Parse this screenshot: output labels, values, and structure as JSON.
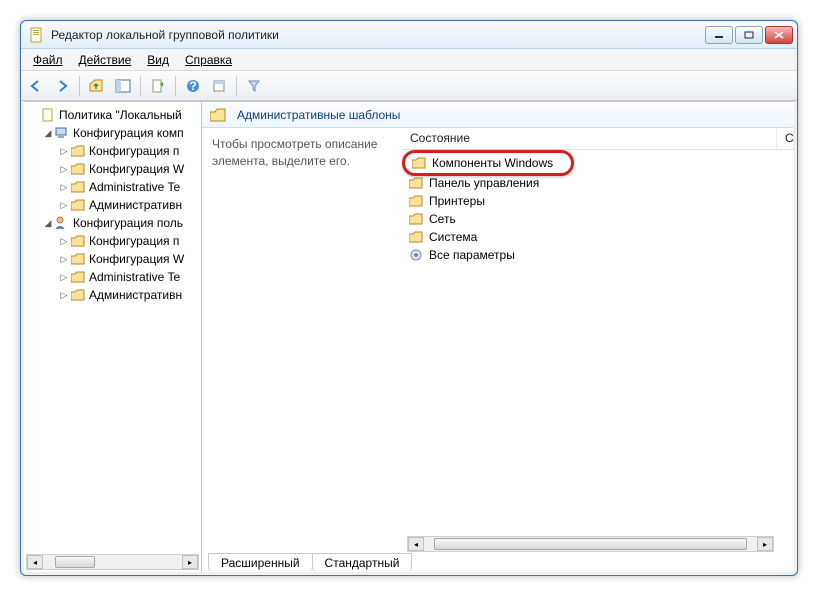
{
  "title": "Редактор локальной групповой политики",
  "menus": {
    "file": "Файл",
    "action": "Действие",
    "view": "Вид",
    "help": "Справка"
  },
  "tree": {
    "root": "Политика \"Локальный",
    "compConfig": "Конфигурация комп",
    "compItems": [
      "Конфигурация п",
      "Конфигурация W",
      "Administrative Te",
      "Административн"
    ],
    "userConfig": "Конфигурация поль",
    "userItems": [
      "Конфигурация п",
      "Конфигурация W",
      "Administrative Te",
      "Административн"
    ]
  },
  "content": {
    "heading": "Административные шаблоны",
    "descLine1": "Чтобы просмотреть описание",
    "descLine2": "элемента, выделите его.",
    "stateCol": "Состояние",
    "items": [
      "Компоненты Windows",
      "Панель управления",
      "Принтеры",
      "Сеть",
      "Система",
      "Все параметры"
    ]
  },
  "tabs": {
    "extended": "Расширенный",
    "standard": "Стандартный"
  }
}
